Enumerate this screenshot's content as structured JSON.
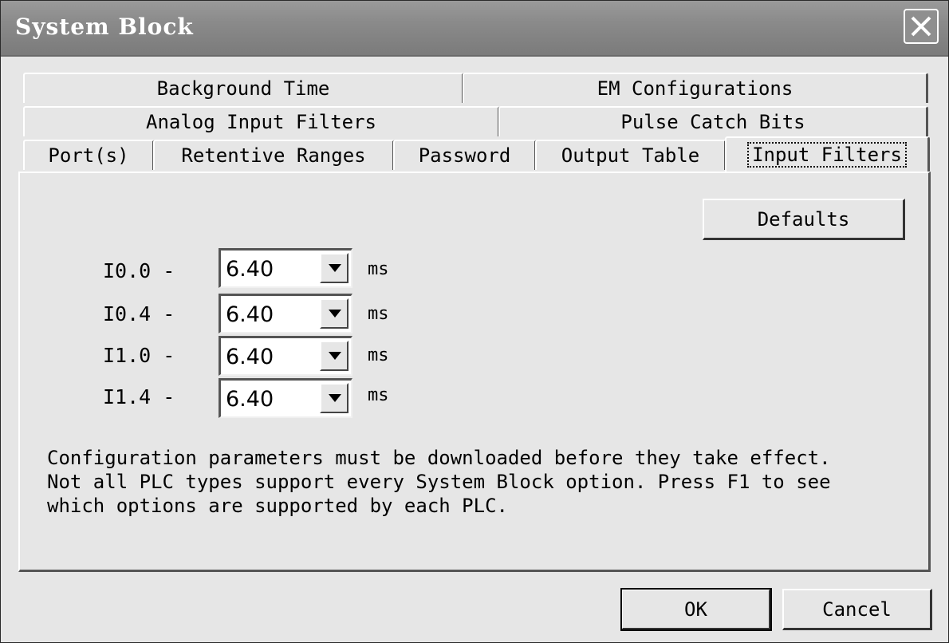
{
  "window": {
    "title": "System Block"
  },
  "tabs": {
    "row1": [
      "Background Time",
      "EM Configurations"
    ],
    "row2": [
      "Analog Input Filters",
      "Pulse Catch Bits"
    ],
    "row3": [
      "Port(s)",
      "Retentive Ranges",
      "Password",
      "Output Table",
      "Input Filters"
    ],
    "active": "Input Filters"
  },
  "panel": {
    "defaults_label": "Defaults",
    "filters": [
      {
        "label": "I0.0 -",
        "value": "6.40",
        "unit": "ms"
      },
      {
        "label": "I0.4 -",
        "value": "6.40",
        "unit": "ms"
      },
      {
        "label": "I1.0 -",
        "value": "6.40",
        "unit": "ms"
      },
      {
        "label": "I1.4 -",
        "value": "6.40",
        "unit": "ms"
      }
    ],
    "note": [
      "Configuration parameters must be downloaded before they take effect.",
      "Not all PLC types support every System Block option. Press F1 to see",
      "which options are supported by each PLC."
    ]
  },
  "footer": {
    "ok_label": "OK",
    "cancel_label": "Cancel"
  },
  "icons": {
    "close": "close-icon",
    "dropdown": "chevron-down-icon"
  }
}
